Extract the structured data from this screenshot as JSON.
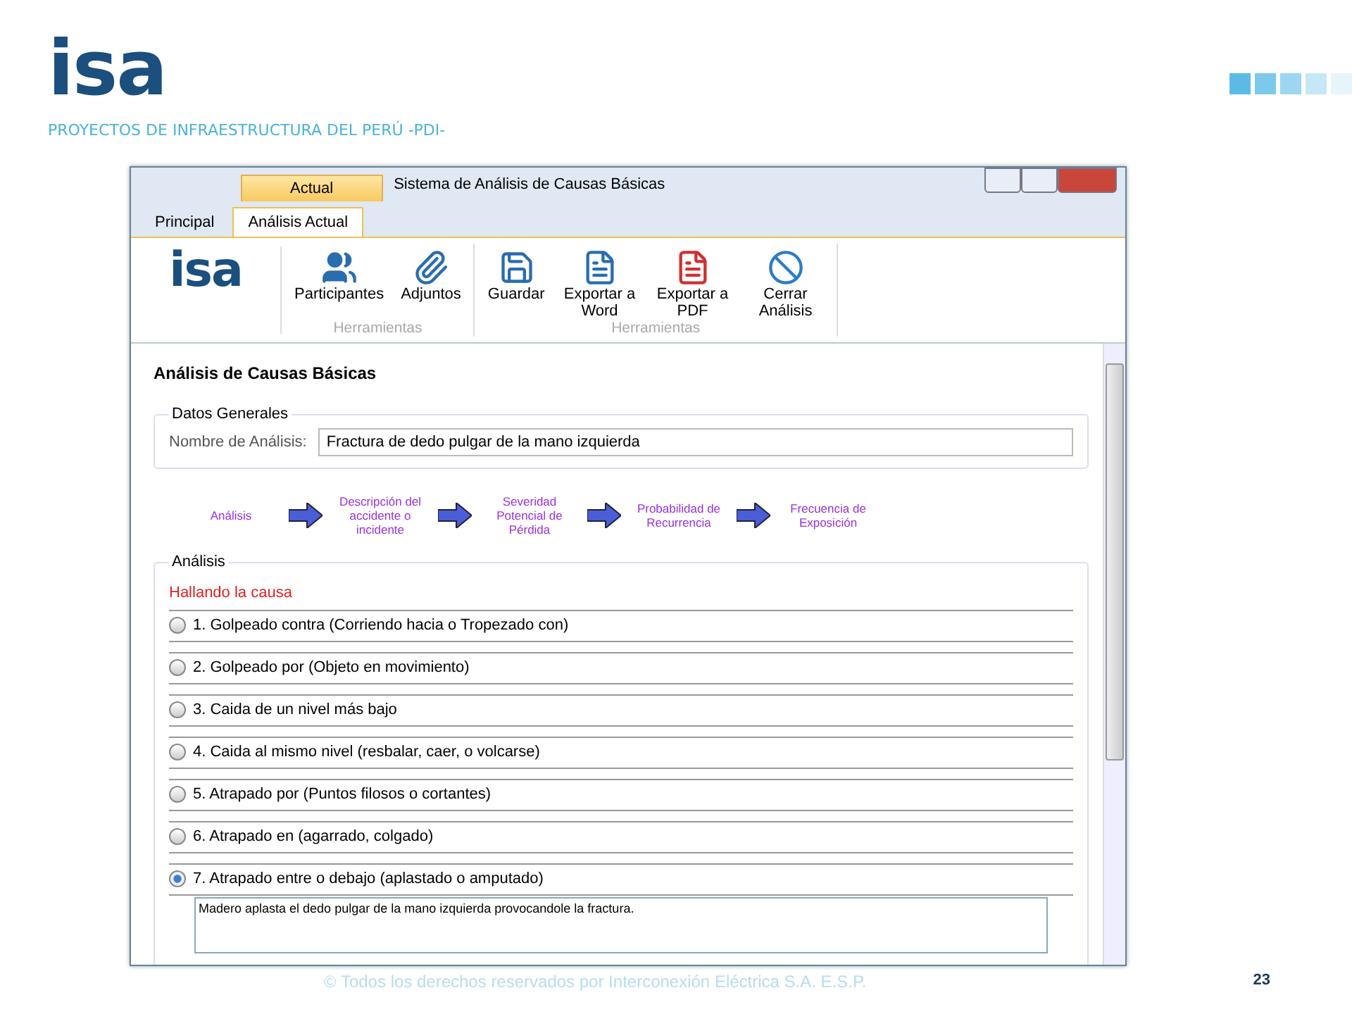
{
  "slide": {
    "logo": "isa",
    "subtitle": "PROYECTOS DE INFRAESTRUCTURA DEL PERÚ -PDI-",
    "footer": "© Todos los derechos reservados por Interconexión Eléctrica S.A. E.S.P.",
    "page": "23"
  },
  "window": {
    "title": "Sistema de Análisis de Causas Básicas",
    "context_tab": "Actual"
  },
  "tabs": [
    {
      "label": "Principal",
      "selected": false
    },
    {
      "label": "Análisis Actual",
      "selected": true
    }
  ],
  "ribbon": {
    "logo": "isa",
    "groups": [
      {
        "label": "Herramientas",
        "buttons": [
          {
            "kind": "people",
            "label": "Participantes"
          },
          {
            "kind": "clip",
            "label": "Adjuntos"
          }
        ]
      },
      {
        "label": "Herramientas",
        "buttons": [
          {
            "kind": "save",
            "label": "Guardar"
          },
          {
            "kind": "word",
            "label": "Exportar a Word"
          },
          {
            "kind": "pdf",
            "label": "Exportar a PDF"
          },
          {
            "kind": "cancel",
            "label": "Cerrar Análisis"
          }
        ]
      }
    ]
  },
  "page_title": "Análisis de Causas Básicas",
  "general": {
    "legend": "Datos Generales",
    "label": "Nombre de Análisis:",
    "value": "Fractura de dedo pulgar de la mano izquierda"
  },
  "steps": [
    "Análisis",
    "Descripción del accidente o incidente",
    "Severidad Potencial de Pérdida",
    "Probabilidad de Recurrencia",
    "Frecuencia de Exposición"
  ],
  "analysis": {
    "legend": "Análisis",
    "heading": "Hallando la causa",
    "options": [
      {
        "label": "1. Golpeado contra (Corriendo hacia o Tropezado con)",
        "selected": false
      },
      {
        "label": "2. Golpeado por (Objeto en movimiento)",
        "selected": false
      },
      {
        "label": "3. Caida de un nivel más bajo",
        "selected": false
      },
      {
        "label": "4. Caida al mismo nivel (resbalar, caer, o volcarse)",
        "selected": false
      },
      {
        "label": "5. Atrapado por (Puntos filosos o cortantes)",
        "selected": false
      },
      {
        "label": "6. Atrapado en (agarrado, colgado)",
        "selected": false
      },
      {
        "label": "7. Atrapado entre o debajo (aplastado o amputado)",
        "selected": true,
        "note": "Madero aplasta el dedo pulgar de la mano izquierda provocandole la fractura."
      }
    ]
  }
}
